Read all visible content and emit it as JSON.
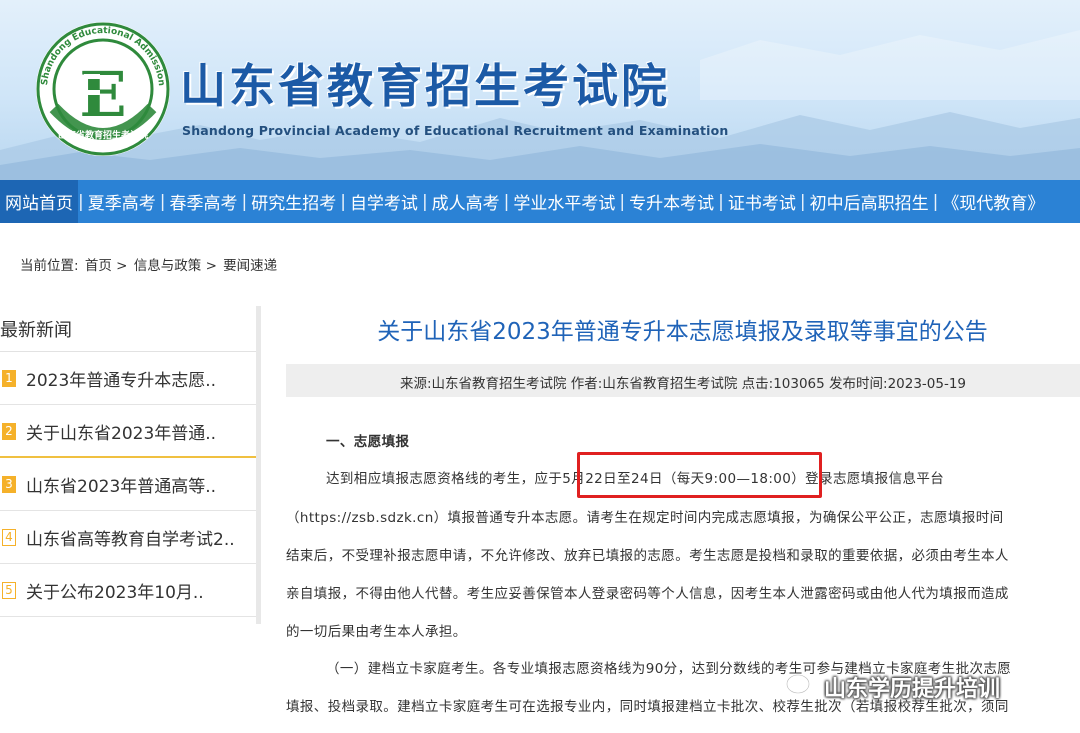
{
  "header": {
    "site_title": "山东省教育招生考试院",
    "site_subtitle": "Shandong Provincial Academy of Educational Recruitment and Examination",
    "emblem_ring_text": "Shandong Educational Admission & Examinations",
    "emblem_bottom_text": "山东省教育招生考试院",
    "emblem_letter": "E",
    "brand_color": "#1c5aa6",
    "emblem_green": "#2f8a3c"
  },
  "nav": {
    "bar_color": "#2b82d5",
    "items": [
      {
        "label": "网站首页",
        "active": true
      },
      {
        "label": "夏季高考"
      },
      {
        "label": "春季高考"
      },
      {
        "label": "研究生招考"
      },
      {
        "label": "自学考试"
      },
      {
        "label": "成人高考"
      },
      {
        "label": "学业水平考试"
      },
      {
        "label": "专升本考试"
      },
      {
        "label": "证书考试"
      },
      {
        "label": "初中后高职招生"
      },
      {
        "label": "《现代教育》"
      }
    ],
    "separator": "|"
  },
  "breadcrumb": {
    "prefix": "当前位置:",
    "items": [
      "首页",
      "信息与政策",
      "要闻速递"
    ],
    "separator": ">"
  },
  "sidebar": {
    "title": "最新新闻",
    "items": [
      {
        "num": "1",
        "label": "2023年普通专升本志愿.."
      },
      {
        "num": "2",
        "label": "关于山东省2023年普通.."
      },
      {
        "num": "3",
        "label": "山东省2023年普通高等.."
      },
      {
        "num": "4",
        "label": "山东省高等教育自学考试2.."
      },
      {
        "num": "5",
        "label": "关于公布2023年10月.."
      }
    ],
    "accent_color": "#f5b12a"
  },
  "article": {
    "title": "关于山东省2023年普通专升本志愿填报及录取等事宜的公告",
    "title_color": "#1f63b8",
    "meta": "来源:山东省教育招生考试院 作者:山东省教育招生考试院 点击:103065 发布时间:2023-05-19",
    "body": [
      {
        "text": "一、志愿填报",
        "type": "heading"
      },
      {
        "text": "达到相应填报志愿资格线的考生，应于5月22日至24日（每天9:00—18:00）登录志愿填报信息平台",
        "type": "indent"
      },
      {
        "text": "（https://zsb.sdzk.cn）填报普通专升本志愿。请考生在规定时间内完成志愿填报，为确保公平公正，志愿填报时间",
        "type": "plain"
      },
      {
        "text": "结束后，不受理补报志愿申请，不允许修改、放弃已填报的志愿。考生志愿是投档和录取的重要依据，必须由考生本人",
        "type": "plain"
      },
      {
        "text": "亲自填报，不得由他人代替。考生应妥善保管本人登录密码等个人信息，因考生本人泄露密码或由他人代为填报而造成",
        "type": "plain"
      },
      {
        "text": "的一切后果由考生本人承担。",
        "type": "plain"
      },
      {
        "text": "（一）建档立卡家庭考生。各专业填报志愿资格线为90分，达到分数线的考生可参与建档立卡家庭考生批次志愿",
        "type": "indent"
      },
      {
        "text": "填报、投档录取。建档立卡家庭考生可在选报专业内，同时填报建档立卡批次、校荐生批次（若填报校荐生批次，须同",
        "type": "plain"
      }
    ],
    "highlight_color": "#e02020"
  },
  "watermark": {
    "text": "山东学历提升培训"
  }
}
